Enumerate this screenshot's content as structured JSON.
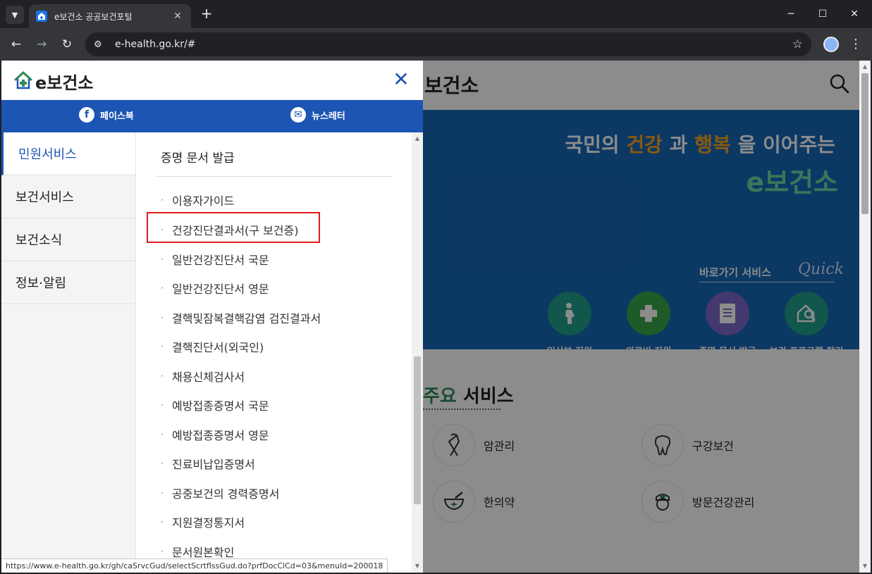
{
  "browser": {
    "tab_title": "e보건소 공공보건포털",
    "tab_close": "✕",
    "new_tab": "+",
    "url": "e-health.go.kr/#",
    "window_minimize": "─",
    "window_maximize": "☐",
    "window_close": "✕"
  },
  "site": {
    "logo_text": "보건소",
    "hero_title_pre": "국민의 ",
    "hero_title_hl1": "건강",
    "hero_title_mid": " 과 ",
    "hero_title_hl2": "행복",
    "hero_title_post": " 을 이어주는",
    "hero_brand": "e보건소",
    "quick_label": "바로가기 서비스",
    "quick_en": "Quick",
    "quick_items": [
      {
        "label": "임산부 지원",
        "color": "#1f9e89"
      },
      {
        "label": "의료비 지원",
        "color": "#3aa64a"
      },
      {
        "label": "증명 문서 발급",
        "color": "#7b68c9"
      },
      {
        "label": "보건 프로그램 찾기",
        "color": "#1f9e89"
      }
    ],
    "services_title_accent": "주요",
    "services_title_rest": " 서비스",
    "services": [
      {
        "label": "암관리",
        "icon": "ribbon-icon"
      },
      {
        "label": "구강보건",
        "icon": "tooth-icon"
      },
      {
        "label": "한의약",
        "icon": "mortar-icon"
      },
      {
        "label": "방문건강관리",
        "icon": "nurse-icon"
      }
    ]
  },
  "drawer": {
    "logo_text": "e보건소",
    "close": "✕",
    "sns": [
      {
        "label": "페이스북",
        "icon": "f"
      },
      {
        "label": "뉴스레터",
        "icon": "✉"
      }
    ],
    "categories": [
      {
        "label": "민원서비스",
        "active": true
      },
      {
        "label": "보건서비스",
        "active": false
      },
      {
        "label": "보건소식",
        "active": false
      },
      {
        "label": "정보·알림",
        "active": false
      }
    ],
    "sub_title": "증명 문서 발급",
    "sub_items": [
      "이용자가이드",
      "건강진단결과서(구 보건증)",
      "일반건강진단서 국문",
      "일반건강진단서 영문",
      "결핵및잠복결핵감염 검진결과서",
      "결핵진단서(외국인)",
      "채용신체검사서",
      "예방접종증명서 국문",
      "예방접종증명서 영문",
      "진료비납입증명서",
      "공중보건의 경력증명서",
      "지원결정통지서",
      "문서원본확인"
    ],
    "bullet": "·"
  },
  "status_url": "https://www.e-health.go.kr/gh/caSrvcGud/selectScrtflssGud.do?prfDocClCd=03&menuId=200018"
}
